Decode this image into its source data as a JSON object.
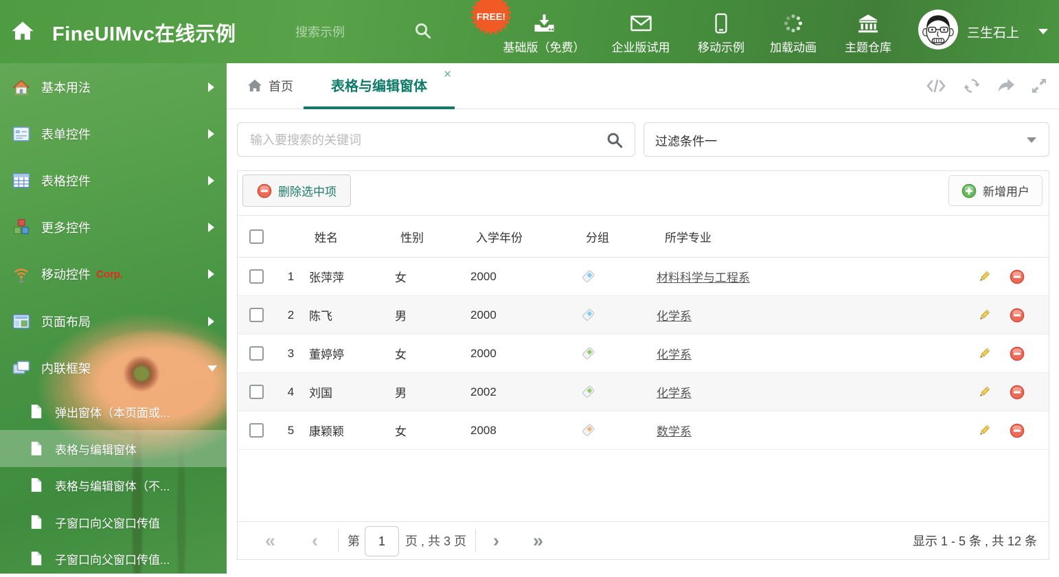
{
  "header": {
    "title": "FineUIMvc在线示例",
    "search_placeholder": "搜索示例",
    "free_badge": "FREE!",
    "nav_items": [
      {
        "label": "基础版（免费）",
        "icon": "download-icon"
      },
      {
        "label": "企业版试用",
        "icon": "envelope-icon"
      },
      {
        "label": "移动示例",
        "icon": "mobile-icon"
      },
      {
        "label": "加载动画",
        "icon": "spinner-icon"
      },
      {
        "label": "主题仓库",
        "icon": "bank-icon"
      }
    ],
    "user_name": "三生石上"
  },
  "sidebar": {
    "items": [
      {
        "label": "基本用法",
        "icon": "house-icon"
      },
      {
        "label": "表单控件",
        "icon": "form-icon"
      },
      {
        "label": "表格控件",
        "icon": "table-icon"
      },
      {
        "label": "更多控件",
        "icon": "cubes-icon"
      },
      {
        "label": "移动控件",
        "badge": "Corp.",
        "icon": "antenna-icon"
      },
      {
        "label": "页面布局",
        "icon": "layout-icon"
      },
      {
        "label": "内联框架",
        "icon": "frames-icon",
        "expanded": true
      }
    ],
    "subitems": [
      {
        "label": "弹出窗体（本页面或..."
      },
      {
        "label": "表格与编辑窗体",
        "selected": true
      },
      {
        "label": "表格与编辑窗体（不..."
      },
      {
        "label": "子窗口向父窗口传值"
      },
      {
        "label": "子窗口向父窗口传值..."
      }
    ]
  },
  "tabs": {
    "home_label": "首页",
    "active_label": "表格与编辑窗体"
  },
  "filter_bar": {
    "search_placeholder": "输入要搜索的关键词",
    "filter_selected": "过滤条件一"
  },
  "grid": {
    "delete_button": "删除选中项",
    "add_button": "新增用户",
    "columns": {
      "name": "姓名",
      "gender": "性别",
      "year": "入学年份",
      "group": "分组",
      "major": "所学专业"
    },
    "rows": [
      {
        "index": "1",
        "name": "张萍萍",
        "gender": "女",
        "year": "2000",
        "tag_color": "#85cbf0",
        "major": "材料科学与工程系"
      },
      {
        "index": "2",
        "name": "陈飞",
        "gender": "男",
        "year": "2000",
        "tag_color": "#85cbf0",
        "major": "化学系"
      },
      {
        "index": "3",
        "name": "董婷婷",
        "gender": "女",
        "year": "2000",
        "tag_color": "#93c966",
        "major": "化学系"
      },
      {
        "index": "4",
        "name": "刘国",
        "gender": "男",
        "year": "2002",
        "tag_color": "#93c966",
        "major": "化学系"
      },
      {
        "index": "5",
        "name": "康颖颖",
        "gender": "女",
        "year": "2008",
        "tag_color": "#f6b26f",
        "major": "数学系"
      }
    ]
  },
  "pagination": {
    "first": "«",
    "prev": "‹",
    "next": "›",
    "last": "»",
    "label_prefix": "第",
    "page_value": "1",
    "label_suffix": "页 , 共 3 页",
    "summary": "显示 1 - 5 条 , 共 12 条"
  },
  "colors": {
    "accent": "#0d7b67",
    "header_green": "#4d9a42",
    "free_badge": "#f15a24",
    "tag_blue": "#85cbf0",
    "tag_green": "#93c966",
    "tag_orange": "#f6b26f"
  }
}
